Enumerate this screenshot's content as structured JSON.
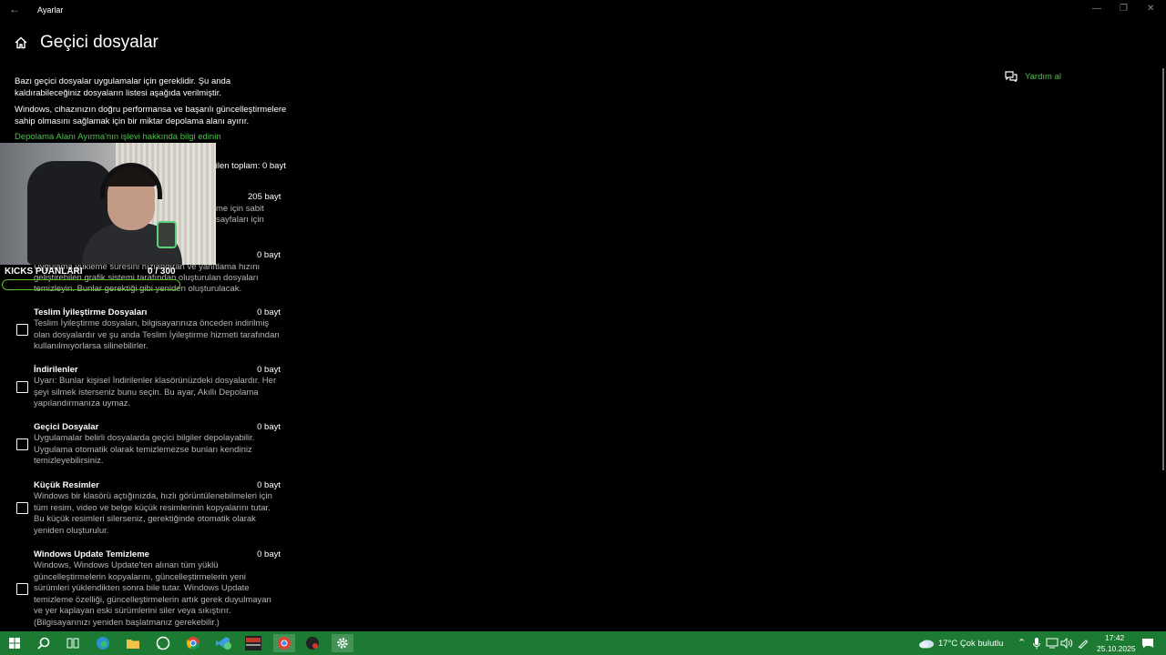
{
  "window": {
    "title": "Ayarlar",
    "back_icon": "←",
    "minimize_icon": "—",
    "restore_icon": "❐",
    "close_icon": "✕"
  },
  "page": {
    "title": "Geçici dosyalar",
    "intro": "Bazı geçici dosyalar uygulamalar için gereklidir. Şu anda kaldırabileceğiniz dosyaların listesi aşağıda verilmiştir.",
    "reserve": "Windows, cihazınızın doğru performansa ve başarılı güncelleştirmelere sahip olmasını sağlamak için bir miktar depolama alanı ayırır.",
    "link": "Depolama Alanı Ayırma'nın işlevi hakkında bilgi edinin",
    "selected_total": "çilen toplam: 0 bayt"
  },
  "partials": {
    "item1_size": "205 bayt",
    "item1_line1": "me için sabit",
    "item1_line2": "sayfaları için",
    "item2_size": "0 bayt",
    "item2_line1": "Uygulama yükleme süresini hızlandıran ve yanıtlama hızını",
    "item2_line2": "geliştirebilen grafik sistemi tarafından oluşturulan dosyaları",
    "item2_line3": "temizleyin. Bunlar gerektiği gibi yeniden oluşturulacak."
  },
  "items": [
    {
      "name": "Teslim İyileştirme Dosyaları",
      "size": "0 bayt",
      "desc": "Teslim İyileştirme dosyaları, bilgisayarınıza önceden indirilmiş olan dosyalardır ve şu anda Teslim İyileştirme hizmeti tarafından kullanılmıyorlarsa silinebilirler."
    },
    {
      "name": "İndirilenler",
      "size": "0 bayt",
      "desc": "Uyarı: Bunlar kişisel İndirilenler klasörünüzdeki dosyalardır. Her şeyi silmek isterseniz bunu seçin. Bu ayar, Akıllı Depolama yapılandırmanıza uymaz."
    },
    {
      "name": "Geçici Dosyalar",
      "size": "0 bayt",
      "desc": "Uygulamalar belirli dosyalarda geçici bilgiler depolayabilir. Uygulama otomatik olarak temizlemezse bunları kendiniz temizleyebilirsiniz."
    },
    {
      "name": "Küçük Resimler",
      "size": "0 bayt",
      "desc": "Windows bir klasörü açtığınızda, hızlı görüntülenebilmeleri için tüm resim, video ve belge küçük resimlerinin kopyalarını tutar. Bu küçük resimleri silerseniz, gerektiğinde otomatik olarak yeniden oluşturulur."
    },
    {
      "name": "Windows Update Temizleme",
      "size": "0 bayt",
      "desc": "Windows, Windows Update'ten alınan tüm yüklü güncelleştirmelerin kopyalarını, güncelleştirmelerin yeni sürümleri yüklendikten sonra bile tutar. Windows Update temizleme özelliği, güncelleştirmelerin artık gerek duyulmayan ve yer kaplayan eski sürümlerini siler veya sıkıştırır. (Bilgisayarınızı yeniden başlatmanız gerekebilir.)"
    }
  ],
  "overlay": {
    "kicks_label": "KICKS PUANLARI",
    "kicks_score": "0  / 300",
    "progress_fraction": 0,
    "accent_color": "#53c21d"
  },
  "help": {
    "label": "Yardım al",
    "icon": "help-chat-icon"
  },
  "taskbar": {
    "weather": "17°C  Çok bulutlu",
    "time": "17:42",
    "date": "25.10.2025",
    "notification_count": "4",
    "color": "#1d7a33",
    "icons": [
      "windows-start-icon",
      "search-icon",
      "task-view-icon",
      "edge-icon",
      "file-explorer-icon",
      "whatsapp-icon",
      "chrome-icon",
      "vscode-icon",
      "obs-icon",
      "chrome-profile-icon",
      "app-icon",
      "settings-icon"
    ]
  },
  "colors": {
    "accent": "#4cc24c",
    "background": "#000000",
    "secondary_text": "#b5b5b5"
  }
}
